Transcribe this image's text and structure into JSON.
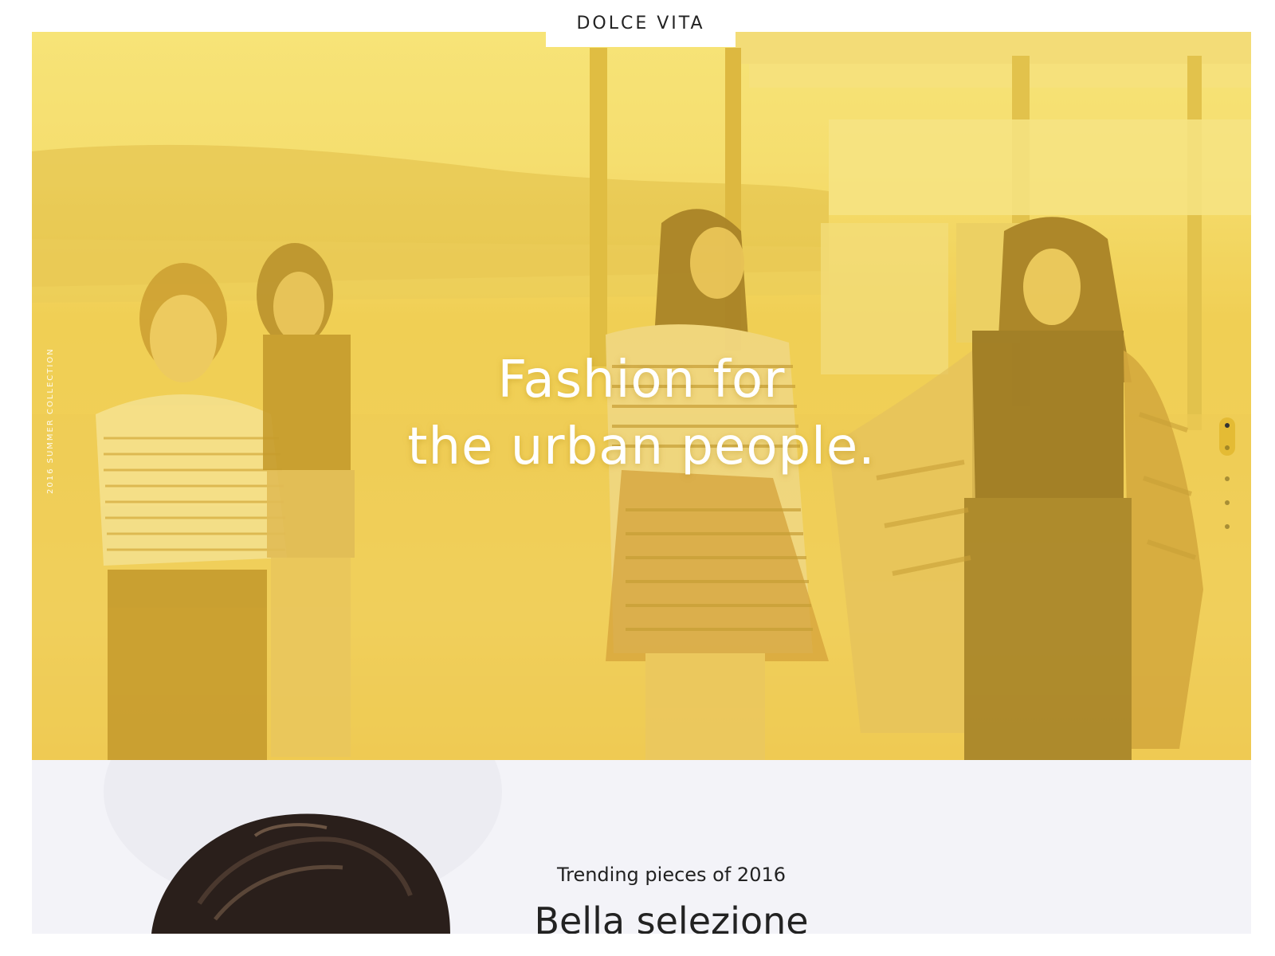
{
  "brand": {
    "logo": "DOLCE VITA"
  },
  "hero": {
    "title_line1": "Fashion for",
    "title_line2": "the urban people.",
    "side_label": "2016 SUMMER COLLECTION",
    "image": "yellow-tinted-photo-of-four-women-walking",
    "accent_color": "#f0cd55"
  },
  "slider": {
    "slide_count": 5,
    "active_index": 1
  },
  "section": {
    "subtitle": "Trending pieces of 2016",
    "title": "Bella selezione",
    "image": "woman-with-dark-hair"
  }
}
